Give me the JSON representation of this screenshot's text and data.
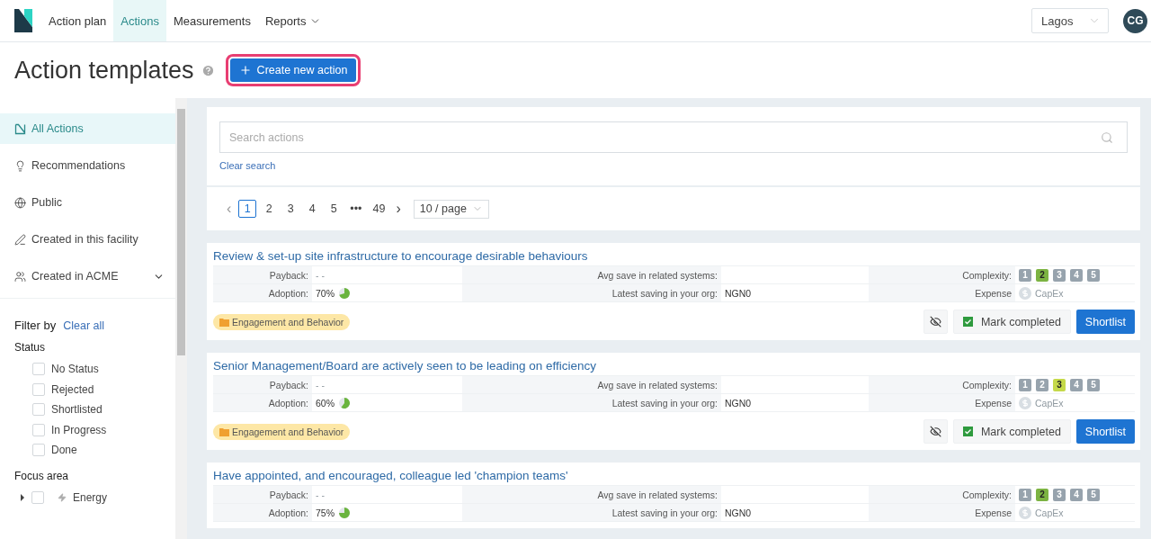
{
  "nav": {
    "items": [
      {
        "label": "Action plan",
        "selected": false,
        "dropdown": false
      },
      {
        "label": "Actions",
        "selected": true,
        "dropdown": false
      },
      {
        "label": "Measurements",
        "selected": false,
        "dropdown": false
      },
      {
        "label": "Reports",
        "selected": false,
        "dropdown": true
      }
    ],
    "location": "Lagos",
    "avatar": "CG"
  },
  "page_title": "Action templates",
  "create_button": "Create new action",
  "sidebar": {
    "items": [
      {
        "kind": "all",
        "label": "All Actions",
        "selected": true,
        "expandable": false
      },
      {
        "kind": "bulb",
        "label": "Recommendations",
        "selected": false,
        "expandable": false
      },
      {
        "kind": "globe",
        "label": "Public",
        "selected": false,
        "expandable": false
      },
      {
        "kind": "pen",
        "label": "Created in this facility",
        "selected": false,
        "expandable": false
      },
      {
        "kind": "users",
        "label": "Created in ACME",
        "selected": false,
        "expandable": true
      }
    ],
    "filter_title": "Filter by",
    "clear_all": "Clear all",
    "status_title": "Status",
    "statuses": [
      {
        "label": "No Status",
        "checked": false
      },
      {
        "label": "Rejected",
        "checked": false
      },
      {
        "label": "Shortlisted",
        "checked": false
      },
      {
        "label": "In Progress",
        "checked": false
      },
      {
        "label": "Done",
        "checked": false
      }
    ],
    "focus_title": "Focus area",
    "focus_areas": [
      {
        "label": "Energy",
        "checked": false
      }
    ]
  },
  "search": {
    "placeholder": "Search actions",
    "clear": "Clear search"
  },
  "pagination": {
    "prev": "‹",
    "next": "›",
    "pages": [
      {
        "label": "1",
        "selected": true
      },
      {
        "label": "2",
        "selected": false
      },
      {
        "label": "3",
        "selected": false
      },
      {
        "label": "4",
        "selected": false
      },
      {
        "label": "5",
        "selected": false
      },
      {
        "label": "•••",
        "selected": false
      },
      {
        "label": "49",
        "selected": false
      }
    ],
    "page_size": "10 / page"
  },
  "actions": [
    {
      "title": "Review & set-up site infrastructure to encourage desirable behaviours",
      "payback_label": "Payback:",
      "payback": "- -",
      "avg_save_label": "Avg save in related systems:",
      "complexity_label": "Complexity:",
      "adoption_label": "Adoption:",
      "adoption": "70%",
      "level": 0.7,
      "latest_label": "Latest saving in your org:",
      "latest": "NGN0",
      "expense_label": "Expense",
      "expense": "CapEx",
      "complexity": [
        {
          "label": "1",
          "selected": false
        },
        {
          "label": "2",
          "selected": true
        },
        {
          "label": "3",
          "selected": false
        },
        {
          "label": "4",
          "selected": false
        },
        {
          "label": "5",
          "selected": false
        }
      ],
      "tag": "Engagement and Behavior",
      "mark": "Mark completed",
      "shortlist": "Shortlist"
    },
    {
      "title": "Senior Management/Board are actively seen to be leading on efficiency",
      "payback_label": "Payback:",
      "payback": "- -",
      "avg_save_label": "Avg save in related systems:",
      "complexity_label": "Complexity:",
      "adoption_label": "Adoption:",
      "adoption": "60%",
      "level": 0.6,
      "latest_label": "Latest saving in your org:",
      "latest": "NGN0",
      "expense_label": "Expense",
      "expense": "CapEx",
      "complexity": [
        {
          "label": "1",
          "selected": false
        },
        {
          "label": "2",
          "selected": false
        },
        {
          "label": "3",
          "selected": true
        },
        {
          "label": "4",
          "selected": false
        },
        {
          "label": "5",
          "selected": false
        }
      ],
      "tag": "Engagement and Behavior",
      "mark": "Mark completed",
      "shortlist": "Shortlist"
    },
    {
      "title": "Have appointed, and encouraged, colleague led 'champion teams'",
      "payback_label": "Payback:",
      "payback": "- -",
      "avg_save_label": "Avg save in related systems:",
      "complexity_label": "Complexity:",
      "adoption_label": "Adoption:",
      "adoption": "75%",
      "level": 0.75,
      "latest_label": "Latest saving in your org:",
      "latest": "NGN0",
      "expense_label": "Expense",
      "expense": "CapEx",
      "complexity": [
        {
          "label": "1",
          "selected": false
        },
        {
          "label": "2",
          "selected": true
        },
        {
          "label": "3",
          "selected": false
        },
        {
          "label": "4",
          "selected": false
        },
        {
          "label": "5",
          "selected": false
        }
      ]
    }
  ]
}
